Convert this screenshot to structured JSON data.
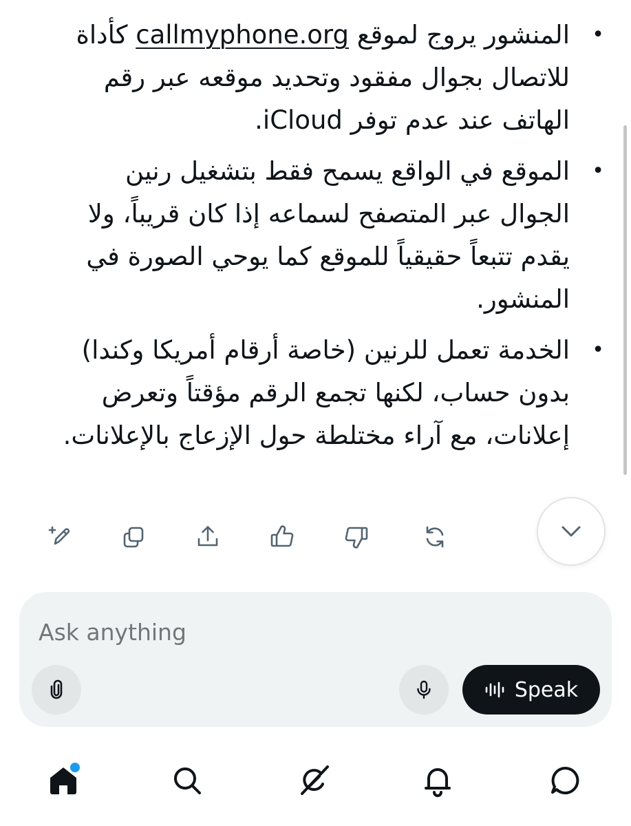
{
  "message": {
    "bullets": [
      {
        "before_link": "المنشور يروج لموقع ",
        "link": "callmyphone.org",
        "after_link": " كأداة للاتصال بجوال مفقود وتحديد موقعه عبر رقم الهاتف عند عدم توفر iCloud."
      },
      {
        "text": "الموقع في الواقع يسمح فقط بتشغيل رنين الجوال عبر المتصفح لسماعه إذا كان قريباً، ولا يقدم تتبعاً حقيقياً للموقع كما يوحي الصورة في المنشور."
      },
      {
        "text": "الخدمة تعمل للرنين (خاصة أرقام أمريكا وكندا) بدون حساب، لكنها تجمع الرقم مؤقتاً وتعرض إعلانات، مع آراء مختلطة حول الإزعاج بالإعلانات."
      }
    ],
    "bullet_glyph": "•"
  },
  "actions": {
    "icons": [
      "edit-icon",
      "copy-icon",
      "share-icon",
      "thumbs-up-icon",
      "thumbs-down-icon",
      "regenerate-icon"
    ],
    "scroll_down_icon": "chevron-down-icon"
  },
  "composer": {
    "placeholder": "Ask anything",
    "value": "",
    "attach_icon": "paperclip-icon",
    "mic_icon": "microphone-icon",
    "speak_label": "Speak",
    "speak_icon": "waveform-icon"
  },
  "bottom_nav": {
    "items": [
      "home-icon",
      "search-icon",
      "grok-icon",
      "bell-icon",
      "messages-icon"
    ],
    "active": "home-icon",
    "notification_dot_color": "#1d9bf0"
  },
  "colors": {
    "text": "#0f1419",
    "composer_bg": "#eff3f4",
    "speak_bg": "#0f1419",
    "placeholder": "#71767b"
  }
}
